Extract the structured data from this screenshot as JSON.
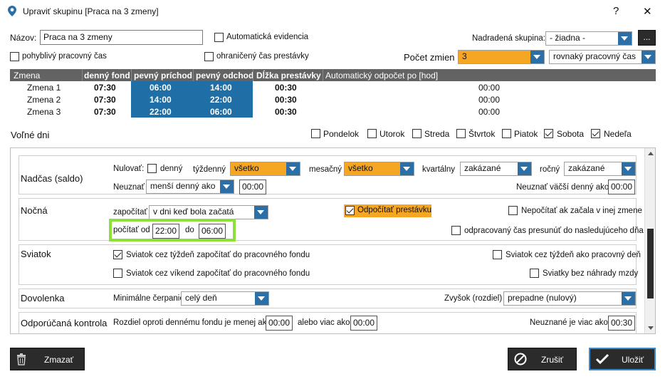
{
  "window": {
    "title": "Upraviť skupinu [Praca na 3 zmeny]",
    "help_label": "?",
    "close_label": "✕"
  },
  "header": {
    "name_label": "Názov:",
    "name_value": "Praca na 3 zmeny",
    "auto_evidence_label": "Automatická evidencia",
    "parent_group_label": "Nadradená skupina:",
    "parent_group_value": "- žiadna -",
    "browse_label": "...",
    "flex_time_label": "pohyblivý pracovný čas",
    "limited_break_label": "ohraničený čas prestávky",
    "shift_count_label": "Počet zmien",
    "shift_count_value": "3",
    "work_time_mode": "rovnaký pracovný čas"
  },
  "shifts_table": {
    "headers": [
      "Zmena",
      "denný fond",
      "pevný príchod",
      "pevný odchod",
      "Dĺžka prestávky",
      "Automatický odpočet po [hod]"
    ],
    "rows": [
      [
        "Zmena 1",
        "07:30",
        "06:00",
        "14:00",
        "00:30",
        "00:00"
      ],
      [
        "Zmena 2",
        "07:30",
        "14:00",
        "22:00",
        "00:30",
        "00:00"
      ],
      [
        "Zmena 3",
        "07:30",
        "22:00",
        "06:00",
        "00:30",
        "00:00"
      ]
    ]
  },
  "free_days": {
    "label": "Voľné dni",
    "days": [
      {
        "label": "Pondelok",
        "checked": false
      },
      {
        "label": "Utorok",
        "checked": false
      },
      {
        "label": "Streda",
        "checked": false
      },
      {
        "label": "Štvrtok",
        "checked": false
      },
      {
        "label": "Piatok",
        "checked": false
      },
      {
        "label": "Sobota",
        "checked": true
      },
      {
        "label": "Nedeľa",
        "checked": true
      }
    ]
  },
  "overtime": {
    "title": "Nadčas (saldo)",
    "reset_label": "Nulovať:",
    "daily_label": "denný",
    "weekly_label": "týždenný",
    "weekly_value": "všetko",
    "monthly_label": "mesačný",
    "monthly_value": "všetko",
    "quarterly_label": "kvartálny",
    "quarterly_value": "zakázané",
    "yearly_label": "ročný",
    "yearly_value": "zakázané",
    "ignore_label": "Neuznať",
    "ignore_value": "menší denný ako",
    "ignore_time": "00:00",
    "ignore_greater_label": "Neuznať väčší denný ako",
    "ignore_greater_time": "00:00"
  },
  "night": {
    "title": "Nočná",
    "count_label": "započítať",
    "count_value": "v dni keď bola začatá",
    "subtract_break_label": "Odpočítať prestávku",
    "not_count_label": "Nepočítať ak začala v inej zmene",
    "count_from_label": "počítať od",
    "from_time": "22:00",
    "to_label": "do",
    "to_time": "06:00",
    "moved_label": "odpracovaný čas presunúť do nasledujúceho dňa"
  },
  "holiday": {
    "title": "Sviatok",
    "week_fund_label": "Sviatok cez týždeň započítať do pracovného fondu",
    "week_workday_label": "Sviatok cez týždeň ako pracovný deň",
    "weekend_fund_label": "Sviatok cez víkend započítať do pracovného fondu",
    "no_compensation_label": "Sviatky bez náhrady mzdy"
  },
  "vacation": {
    "title": "Dovolenka",
    "min_label": "Minimálne čerpanie",
    "min_value": "celý deň",
    "rest_label": "Zvyšok (rozdiel)",
    "rest_value": "prepadne (nulový)"
  },
  "recommended": {
    "title": "Odporúčaná kontrola",
    "diff_label": "Rozdiel oproti dennému fondu je menej ako",
    "diff_time": "00:00",
    "or_label": "alebo viac ako",
    "or_time": "00:00",
    "unrecognized_label": "Neuznané je viac ako",
    "unrecognized_time": "00:30"
  },
  "footer": {
    "delete_label": "Zmazať",
    "cancel_label": "Zrušiť",
    "save_label": "Uložiť"
  },
  "colors": {
    "accent": "#2c6ea6",
    "orange": "#f5a623",
    "highlight": "#8ce03a",
    "table_blue": "#1f6fa6",
    "header_gray": "#636363"
  }
}
